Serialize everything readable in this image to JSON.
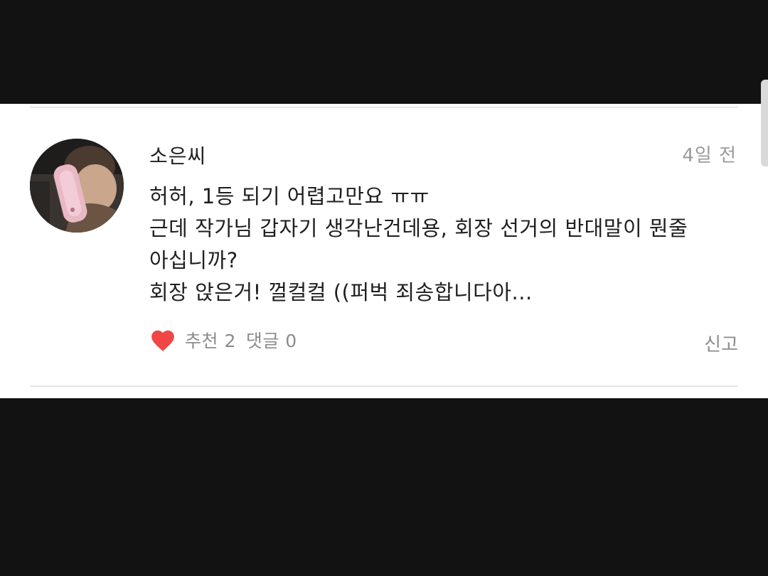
{
  "comment": {
    "username": "소은씨",
    "timestamp": "4일 전",
    "lines": [
      "허허, 1등 되기 어렵고만요 ㅠㅠ",
      "근데 작가님 갑자기 생각난건데용, 회장 선거의 반대말이 뭔줄",
      "아십니까?",
      "회장 앉은거! 껄컬컬 ((퍼벅 죄송합니다아..."
    ],
    "likes_label": "추천 2",
    "replies_label": "댓글 0",
    "report_label": "신고"
  },
  "colors": {
    "background": "#121212",
    "card": "#ffffff",
    "heart": "#f04646",
    "muted_text": "#8c8c8c"
  },
  "icons": {
    "like": "heart-icon"
  }
}
